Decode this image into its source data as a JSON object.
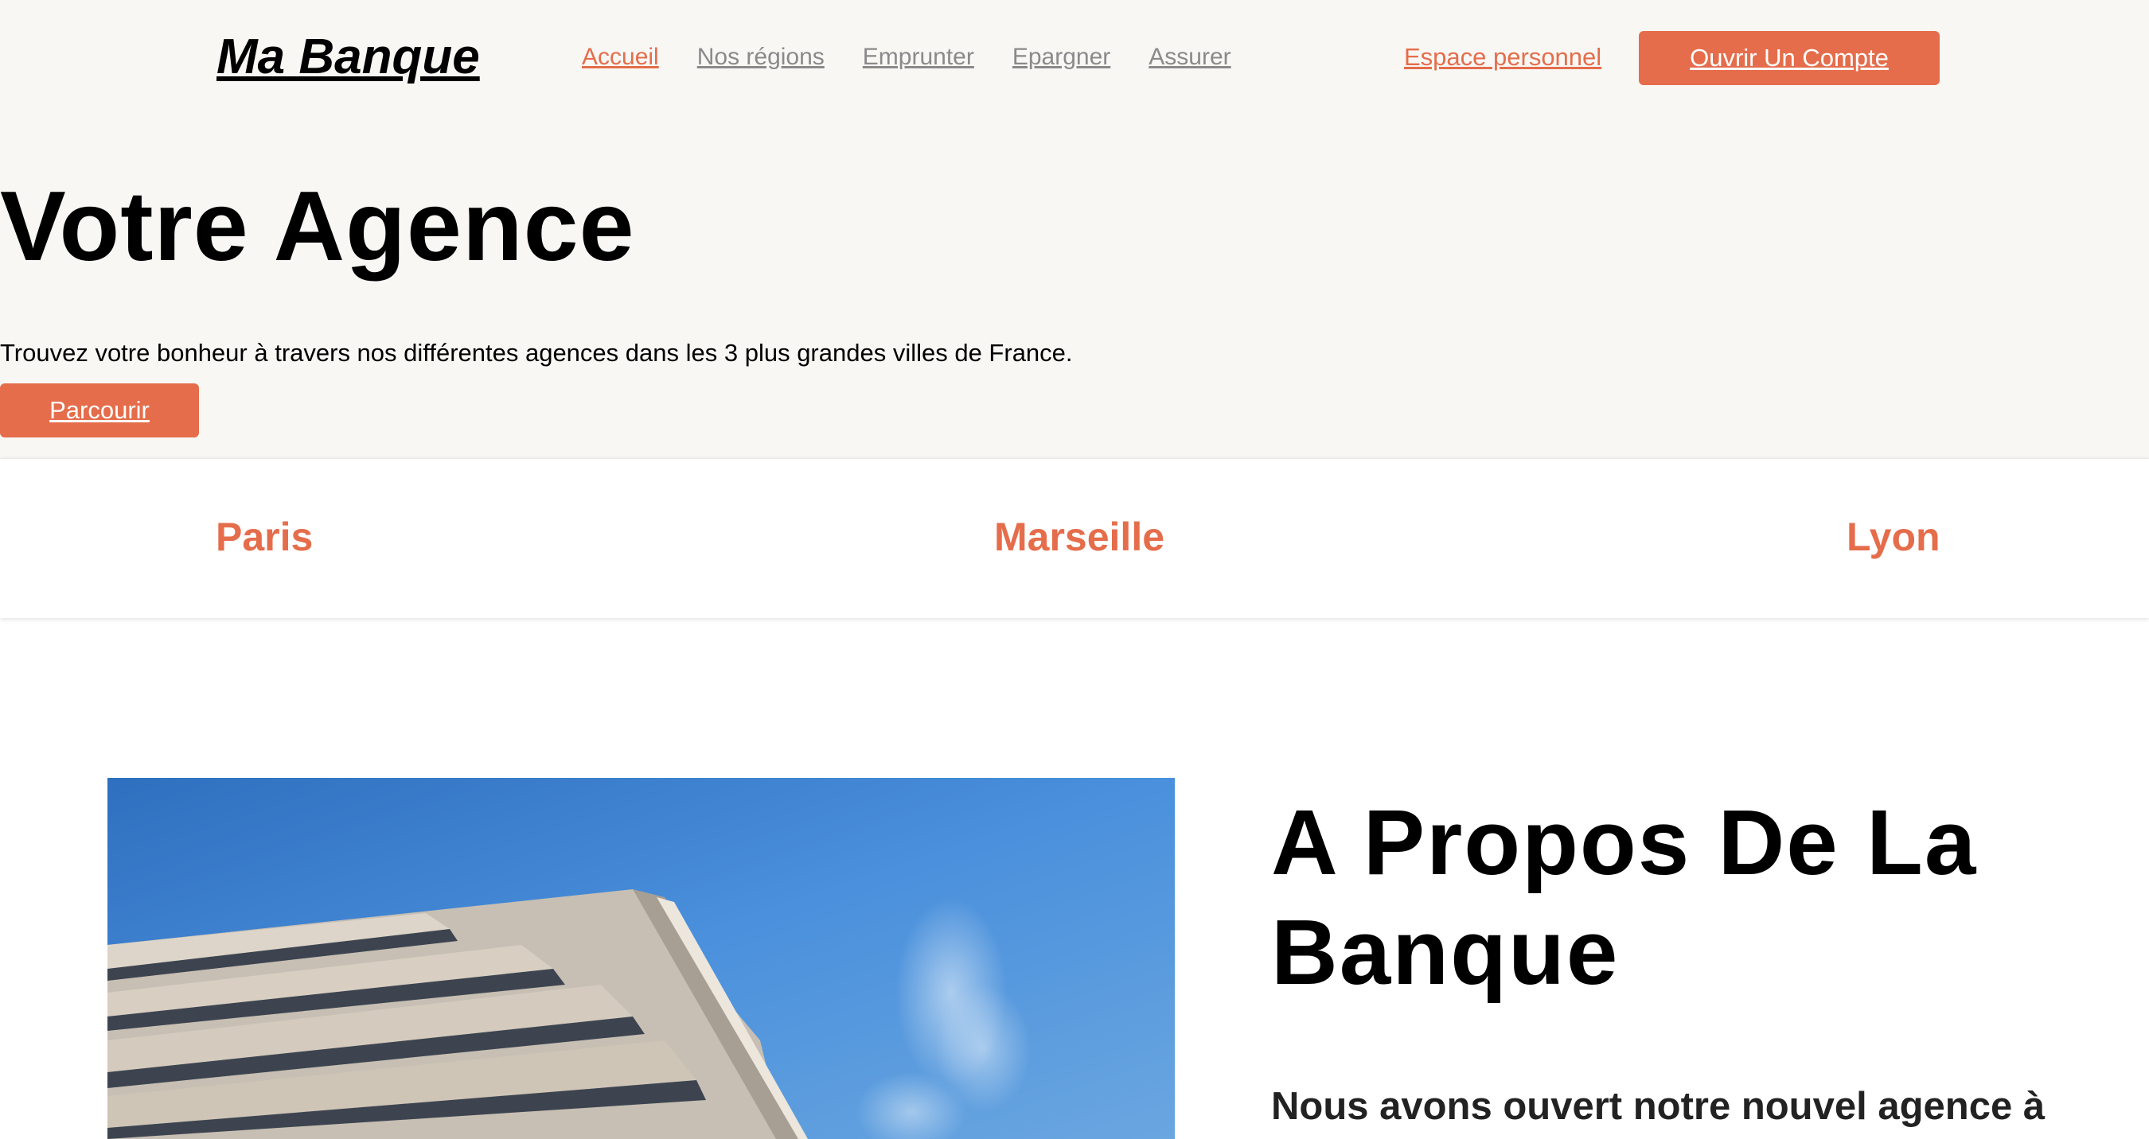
{
  "header": {
    "logo": "Ma Banque",
    "nav": [
      {
        "label": "Accueil",
        "active": true
      },
      {
        "label": "Nos régions",
        "active": false
      },
      {
        "label": "Emprunter",
        "active": false
      },
      {
        "label": "Epargner",
        "active": false
      },
      {
        "label": "Assurer",
        "active": false
      }
    ],
    "espace_label": "Espace personnel",
    "open_account_label": "Ouvrir Un Compte"
  },
  "hero": {
    "title": "Votre Agence",
    "subtitle": "Trouvez votre bonheur à travers nos différentes agences dans les 3 plus grandes villes de France.",
    "button_label": "Parcourir"
  },
  "cities": [
    "Paris",
    "Marseille",
    "Lyon"
  ],
  "about": {
    "title": "A Propos De La Banque",
    "text": "Nous avons ouvert notre nouvel agence à"
  },
  "colors": {
    "accent": "#e56d4b",
    "hero_bg": "#f8f7f4",
    "nav_inactive": "#8a8a8a",
    "sky": "#3f88d4"
  }
}
